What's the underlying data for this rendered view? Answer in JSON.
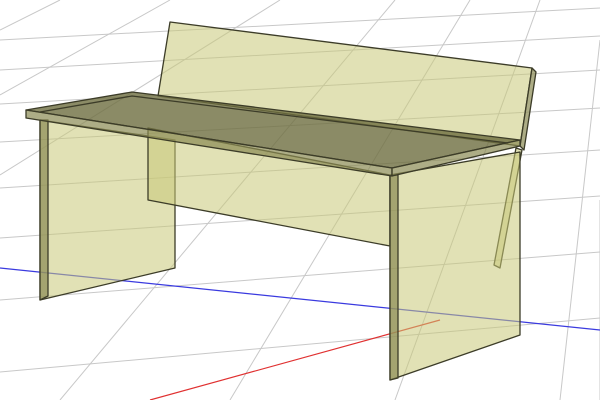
{
  "viewport": {
    "background": "#ffffff",
    "grid_color": "#c8c8c8",
    "x_axis_color": "#e03030",
    "y_axis_color": "#3a3adf",
    "model_fill": "#c8c878",
    "model_fill_dark": "#8a8a52",
    "model_top": "#6e6e40",
    "model_edge": "#3c3c28",
    "model_opacity": 0.55
  },
  "model": {
    "name": "bench",
    "parts": [
      "backrest",
      "seat",
      "left-leg-panel",
      "right-leg-panel",
      "back-support-strut"
    ]
  }
}
